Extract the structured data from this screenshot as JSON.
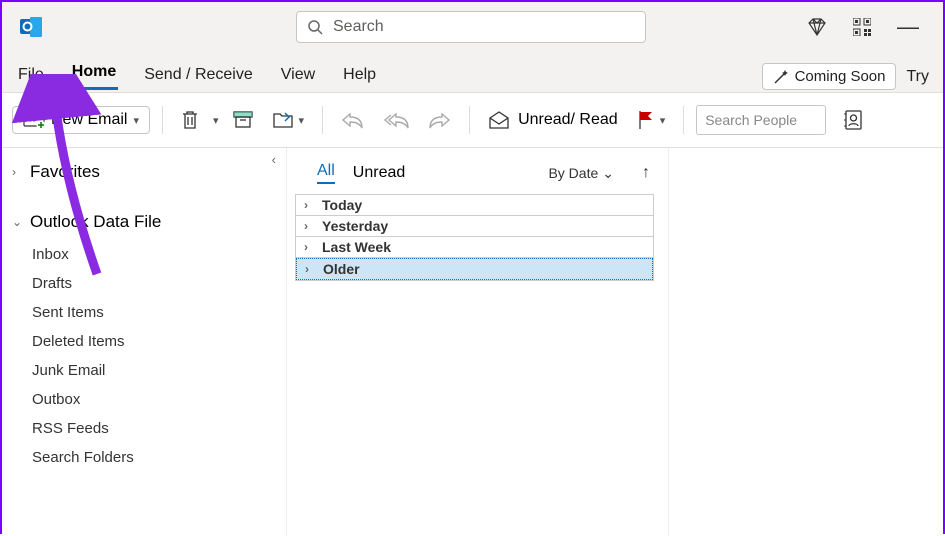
{
  "titlebar": {
    "search_placeholder": "Search"
  },
  "menu": {
    "file": "File",
    "home": "Home",
    "send_receive": "Send / Receive",
    "view": "View",
    "help": "Help",
    "coming_soon": "Coming Soon",
    "try": "Try"
  },
  "ribbon": {
    "new_email": "New Email",
    "unread_read": "Unread/ Read",
    "search_people_placeholder": "Search People"
  },
  "nav": {
    "favorites": "Favorites",
    "data_file": "Outlook Data File",
    "folders": {
      "inbox": "Inbox",
      "drafts": "Drafts",
      "sent": "Sent Items",
      "deleted": "Deleted Items",
      "junk": "Junk Email",
      "outbox": "Outbox",
      "rss": "RSS Feeds",
      "search": "Search Folders"
    }
  },
  "list": {
    "tab_all": "All",
    "tab_unread": "Unread",
    "by_date": "By Date",
    "groups": {
      "today": "Today",
      "yesterday": "Yesterday",
      "last_week": "Last Week",
      "older": "Older"
    }
  }
}
